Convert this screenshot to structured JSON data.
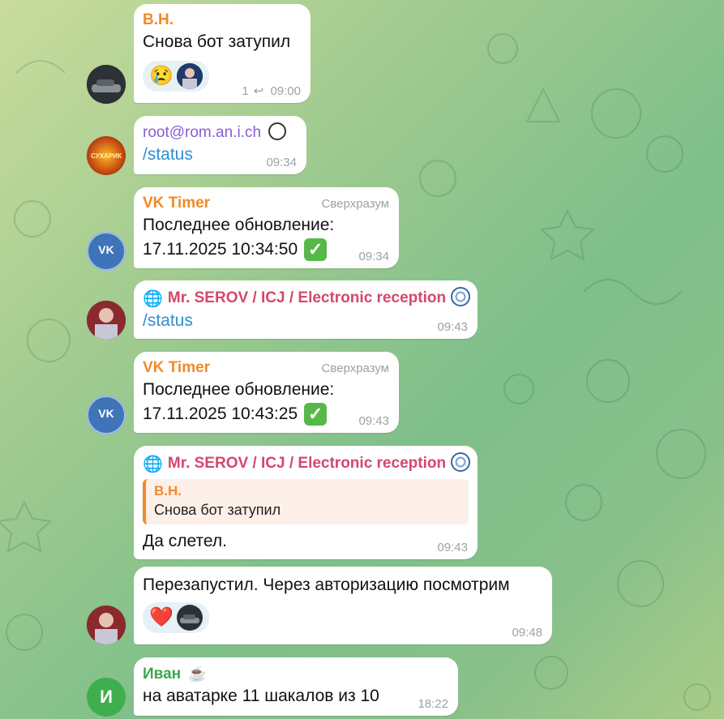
{
  "messages": [
    {
      "sender": "В.Н.",
      "sender_color": "#f08a2a",
      "text": "Снова бот затупил",
      "reactions": [
        {
          "emoji_icon": "crying-face",
          "glyph": "😢"
        }
      ],
      "reply_count": "1",
      "time": "09:00"
    },
    {
      "sender": "root@rom.an.i.ch",
      "sender_color": "#8a5dd6",
      "text": "/status",
      "time": "09:34",
      "avatar_text": "СУХАРИК"
    },
    {
      "sender": "VK Timer",
      "sender_color": "#f08a2a",
      "role": "Сверхразум",
      "line1": "Последнее обновление:",
      "line2": "17.11.2025 10:34:50",
      "time": "09:34"
    },
    {
      "sender": "Mr. SEROV / ICJ / Electronic reception",
      "sender_color": "#d5476c",
      "text": "/status",
      "time": "09:43"
    },
    {
      "sender": "VK Timer",
      "sender_color": "#f08a2a",
      "role": "Сверхразум",
      "line1": "Последнее обновление:",
      "line2": "17.11.2025 10:43:25",
      "time": "09:43"
    },
    {
      "sender": "Mr. SEROV / ICJ / Electronic reception",
      "sender_color": "#d5476c",
      "quote_name": "В.Н.",
      "quote_text": "Снова бот затупил",
      "text": "Да слетел.",
      "time": "09:43"
    },
    {
      "text": "Перезапустил. Через авторизацию посмотрим",
      "reactions": [
        {
          "emoji_icon": "red-heart",
          "glyph": "❤️"
        }
      ],
      "time": "09:48"
    },
    {
      "sender": "Иван",
      "sender_color": "#3aa84c",
      "text": "на аватарке 11 шакалов из 10",
      "time": "18:22",
      "avatar_letter": "И"
    }
  ],
  "colors": {
    "command_link": "#2f8fd1",
    "time_text": "#9aa3a6",
    "check_green": "#57b84a",
    "ivan_avatar": "#3fae4e"
  }
}
